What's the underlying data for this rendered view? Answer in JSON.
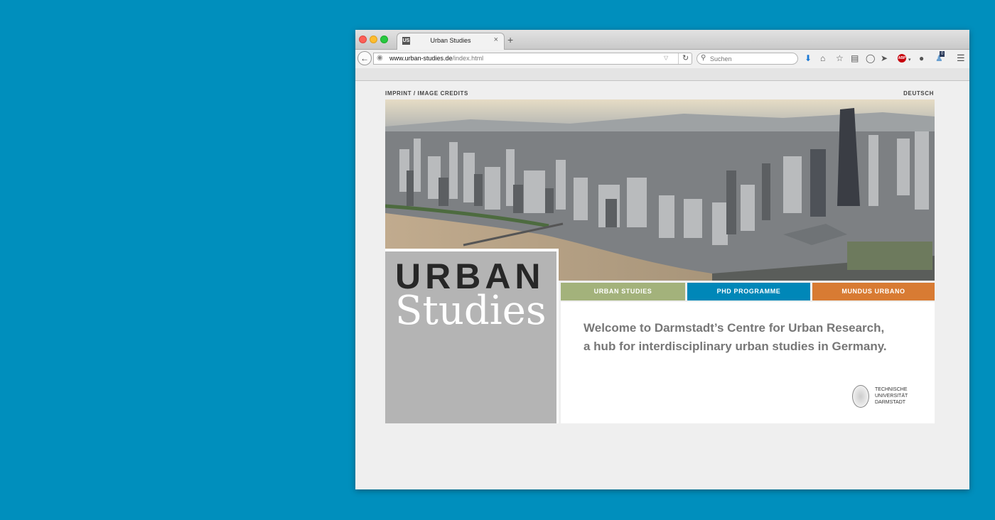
{
  "browser": {
    "tab_title": "Urban Studies",
    "tab_favicon": "US",
    "tab_close": "×",
    "new_tab": "+",
    "url_host": "www.urban-studies.de",
    "url_path": "/index.html",
    "search_placeholder": "Suchen",
    "badge_count": "0",
    "abp_label": "ABP",
    "icons": [
      "back-icon",
      "globe-icon",
      "reload-icon",
      "search-icon",
      "download-icon",
      "home-icon",
      "bookmark-star-icon",
      "reading-list-icon",
      "pocket-icon",
      "send-icon",
      "adblock-icon",
      "chat-icon",
      "user-icon",
      "menu-icon"
    ]
  },
  "page": {
    "top_left_link": "IMPRINT / IMAGE CREDITS",
    "top_right_link": "DEUTSCH",
    "logo_line1": "URBAN",
    "logo_line2": "Studies",
    "nav": [
      {
        "label": "URBAN STUDIES",
        "color": "#a3b27b"
      },
      {
        "label": "PHD PROGRAMME",
        "color": "#0087b8"
      },
      {
        "label": "MUNDUS URBANO",
        "color": "#d87b33"
      }
    ],
    "welcome_line1": "Welcome to Darmstadt’s Centre for Urban Research,",
    "welcome_line2": "a hub for interdisciplinary urban studies in Germany.",
    "university": {
      "line1": "TECHNISCHE",
      "line2": "UNIVERSITÄT",
      "line3": "DARMSTADT"
    }
  },
  "colors": {
    "background": "#008fbd",
    "window": "#efefef"
  }
}
